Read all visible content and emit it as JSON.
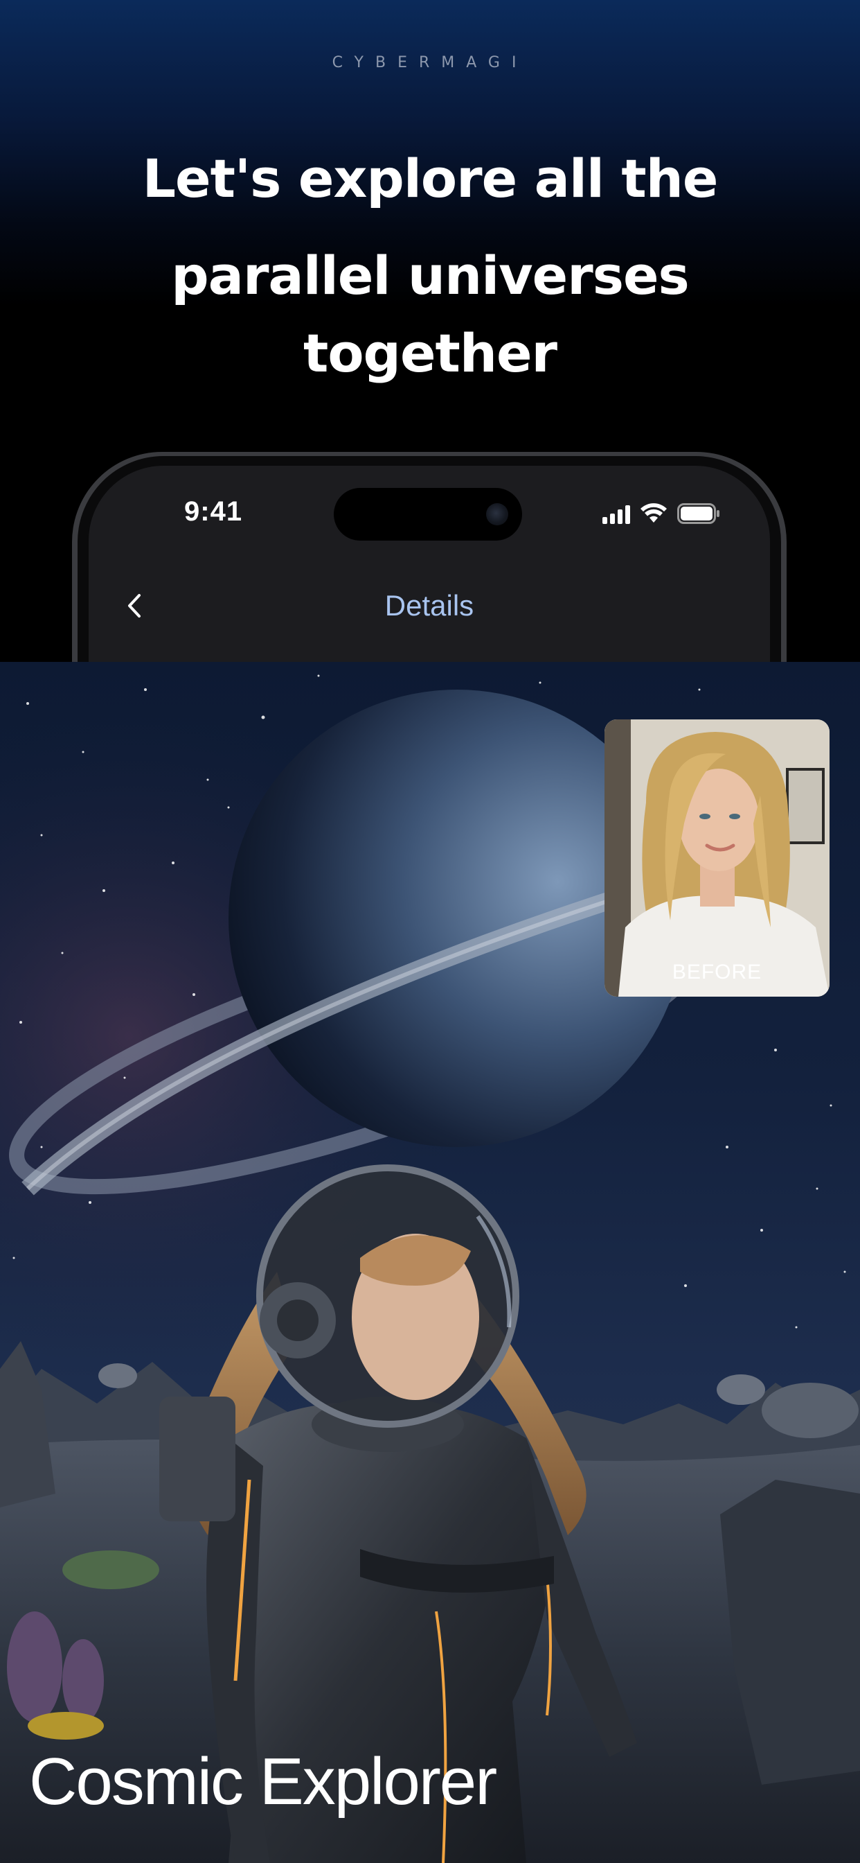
{
  "brand": "CYBERMAGI",
  "headline": {
    "line1": "Let's explore all the",
    "line2": "parallel universes",
    "line3": "together"
  },
  "phone": {
    "status_time": "9:41",
    "nav_title": "Details",
    "icons": [
      "chevron-left-icon",
      "signal-icon",
      "wifi-icon",
      "battery-icon"
    ]
  },
  "before_card": {
    "label": "BEFORE"
  },
  "hero": {
    "title": "Cosmic Explorer"
  },
  "colors": {
    "nav_title": "#a9c4ef",
    "top_gradient": "#0b2a5a",
    "background": "#000000"
  }
}
